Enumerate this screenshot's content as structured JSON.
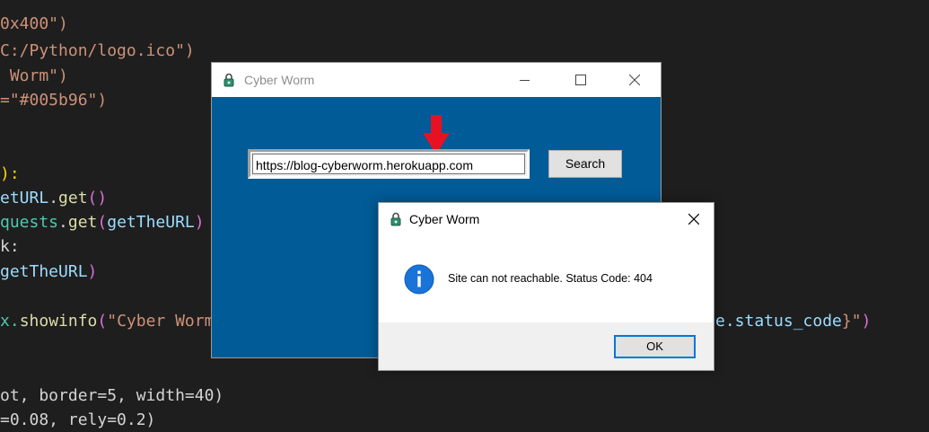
{
  "editor": {
    "l1": {
      "a": "0x400\")"
    },
    "l2": {
      "a": "C:/Python/logo.ico\")"
    },
    "l3": {
      "a": " Worm\")"
    },
    "l4": {
      "a": "=\"#005b96\")"
    },
    "l5": {
      "a": "):"
    },
    "l6": {
      "a": "etURL",
      "b": ".",
      "c": "get",
      "d": "()"
    },
    "l7": {
      "a": "quests",
      "b": ".",
      "c": "get",
      "d": "(",
      "e": "getTheURL",
      "f": ")"
    },
    "l8": {
      "a": "k:"
    },
    "l9": {
      "a": "getTheURL",
      "b": ")"
    },
    "l10": {
      "a": "x.",
      "b": "showinfo",
      "c": "(",
      "d": "\"Cyber Worm"
    },
    "l10r": {
      "a": "e.status_code",
      "b": "}\"",
      "c": ")"
    },
    "l11": {
      "a": "ot, border=5, width=40)"
    },
    "l12": {
      "a": "=0.08, rely=0.2)"
    }
  },
  "main_window": {
    "title": "Cyber Worm",
    "url_value": "https://blog-cyberworm.herokuapp.com",
    "search_label": "Search"
  },
  "message_box": {
    "title": "Cyber Worm",
    "message": "Site can not reachable. Status Code: 404",
    "ok_label": "OK"
  },
  "colors": {
    "window_bg": "#005b96",
    "editor_bg": "#1e1e1e",
    "arrow": "#e81123",
    "info_icon": "#1a73d9",
    "ok_border": "#0078d7"
  },
  "icons": [
    "app-lock-icon",
    "minimize-icon",
    "maximize-icon",
    "close-icon",
    "info-icon",
    "red-arrow-icon"
  ]
}
